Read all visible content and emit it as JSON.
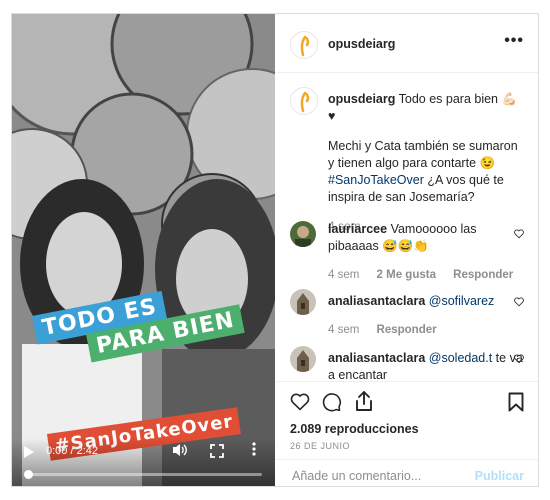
{
  "post": {
    "account": "opusdeiarg",
    "more_icon": "more-horizontal-icon"
  },
  "video": {
    "stickers": [
      "TODO ES",
      "PARA BIEN",
      "#SanJoTakeOver"
    ],
    "time": "0:00 / 2:42",
    "progress_fraction": 0.0,
    "icons": [
      "play-icon",
      "volume-icon",
      "fullscreen-icon",
      "more-vertical-icon"
    ]
  },
  "caption": {
    "username": "opusdeiarg",
    "headline": "Todo es para bien 💪🏻 ♥",
    "text_a": "Mechi y Cata también se sumaron y tienen algo para contarte 😉",
    "hashtag": "#SanJoTakeOver",
    "text_b": " ¿A vos qué te inspira de san Josemaría?",
    "time": "4 sem"
  },
  "comments": [
    {
      "username": "lauriarcee",
      "text": "Vamoooooo las pibaaaas 😅😅👏",
      "time": "4 sem",
      "likes": "2 Me gusta",
      "reply": "Responder"
    },
    {
      "username": "analiasantaclara",
      "mention": "@sofilvarez",
      "time": "4 sem",
      "reply": "Responder"
    },
    {
      "username": "analiasantaclara",
      "mention": "@soledad.t",
      "text": " te va a encantar"
    }
  ],
  "actions": {
    "views": "2.089 reproducciones",
    "date": "26 DE JUNIO",
    "comment_placeholder": "Añade un comentario...",
    "publish": "Publicar"
  },
  "colors": {
    "brand_orange": "#f5a623",
    "link_blue": "#00376b",
    "muted": "#8e8e8e",
    "publish_disabled": "#b2dffc",
    "sticker_blue": "#3aa0d6",
    "sticker_green": "#4caf6e",
    "sticker_red": "#e04e35"
  }
}
